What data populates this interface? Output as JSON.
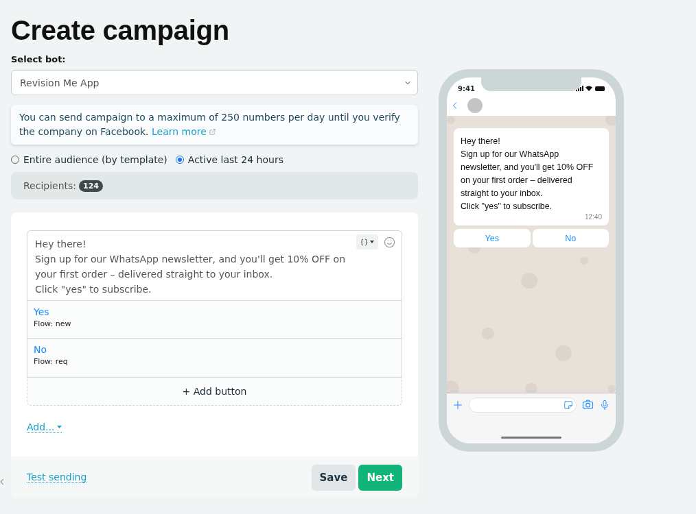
{
  "title": "Create campaign",
  "bot_select": {
    "label": "Select bot:",
    "value": "Revision Me App"
  },
  "notice": {
    "text": "You can send campaign to a maximum of 250 numbers per day until you verify the company on Facebook.",
    "link": "Learn more"
  },
  "audience": [
    {
      "label": "Entire audience (by template)",
      "selected": false
    },
    {
      "label": "Active last 24 hours",
      "selected": true
    }
  ],
  "recipients": {
    "label": "Recipients:",
    "count": "124"
  },
  "editor": {
    "message_lines": [
      "Hey there!",
      "Sign up for our WhatsApp newsletter, and you'll get 10% OFF on",
      "your first order – delivered straight to your inbox.",
      "Click \"yes\" to subscribe."
    ],
    "buttons": [
      {
        "label": "Yes",
        "flow": "Flow: new"
      },
      {
        "label": "No",
        "flow": "Flow: req"
      }
    ],
    "add_button": "+ Add button",
    "add_menu": "Add..."
  },
  "footer": {
    "test_link": "Test sending",
    "save": "Save",
    "next": "Next"
  },
  "phone": {
    "time": "9:41",
    "message_lines": [
      "Hey there!",
      "Sign up for our WhatsApp",
      "newsletter, and you'll get 10% OFF",
      "on your first order – delivered",
      "straight to your inbox.",
      "Click \"yes\" to subscribe."
    ],
    "message_time": "12:40",
    "replies": [
      "Yes",
      "No"
    ]
  }
}
